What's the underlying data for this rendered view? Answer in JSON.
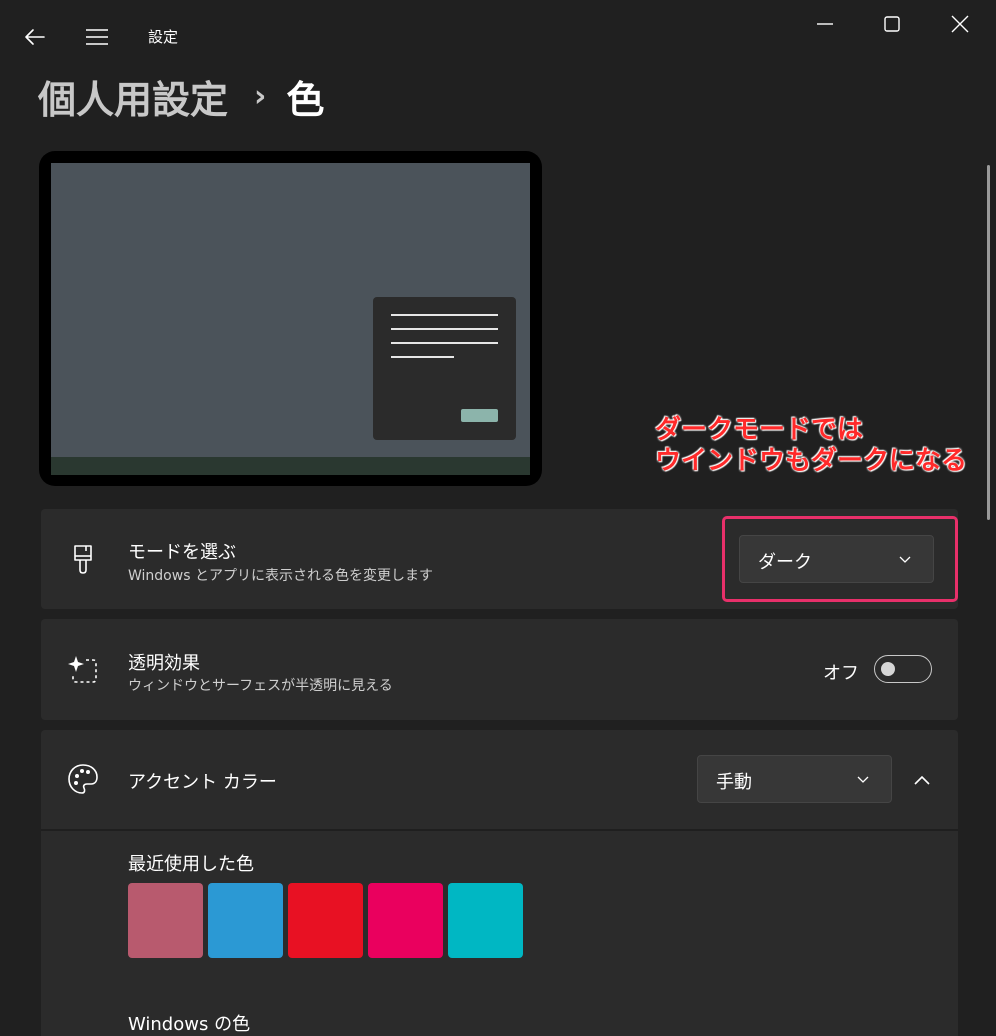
{
  "titlebar": {
    "back_icon": "back-arrow-icon",
    "menu_icon": "hamburger-menu-icon",
    "app_title": "設定",
    "controls": [
      "minimize-icon",
      "maximize-icon",
      "close-icon"
    ]
  },
  "breadcrumb": {
    "parent": "個人用設定",
    "separator": "›",
    "current": "色"
  },
  "annotation": {
    "line1": "ダークモードでは",
    "line2": "ウインドウもダークになる",
    "color": "#ff2a2a"
  },
  "mode_card": {
    "icon": "paintbrush-icon",
    "title": "モードを選ぶ",
    "subtitle": "Windows とアプリに表示される色を変更します",
    "dropdown_value": "ダーク",
    "highlight_color": "#e8306a"
  },
  "transparency_card": {
    "icon": "transparency-sparkle-icon",
    "title": "透明効果",
    "subtitle": "ウィンドウとサーフェスが半透明に見える",
    "toggle_label": "オフ",
    "toggle_on": false
  },
  "accent_card": {
    "icon": "palette-icon",
    "title": "アクセント カラー",
    "dropdown_value": "手動",
    "expanded": true,
    "recent_label": "最近使用した色",
    "recent_colors": [
      "#b85a6e",
      "#2b99d4",
      "#e81123",
      "#ea005e",
      "#00b7c3"
    ],
    "windows_colors_label": "Windows の色"
  },
  "colors": {
    "background": "#202020",
    "card": "#2b2b2b",
    "dropdown": "#373737"
  }
}
